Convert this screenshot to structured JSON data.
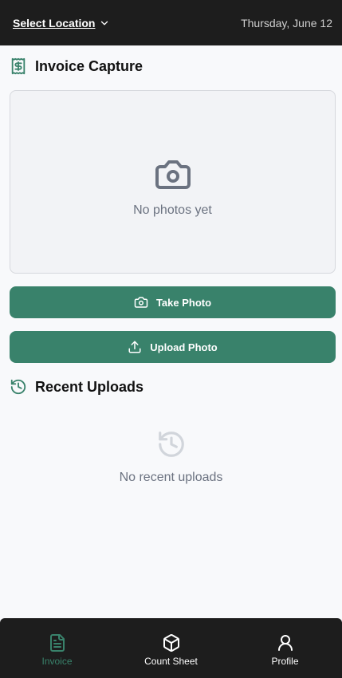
{
  "header": {
    "location_label": "Select Location",
    "date": "Thursday, June 12"
  },
  "invoice": {
    "title": "Invoice Capture",
    "empty_text": "No photos yet",
    "take_photo_label": "Take Photo",
    "upload_photo_label": "Upload Photo"
  },
  "recent": {
    "title": "Recent Uploads",
    "empty_text": "No recent uploads"
  },
  "nav": {
    "items": [
      {
        "label": "Invoice",
        "icon": "file-text-icon",
        "active": true
      },
      {
        "label": "Count Sheet",
        "icon": "box-icon",
        "active": false
      },
      {
        "label": "Profile",
        "icon": "user-icon",
        "active": false
      }
    ]
  },
  "colors": {
    "accent": "#39826b",
    "topbar": "#1d1d1d",
    "muted": "#6b7280",
    "background": "#f8f9fb"
  }
}
